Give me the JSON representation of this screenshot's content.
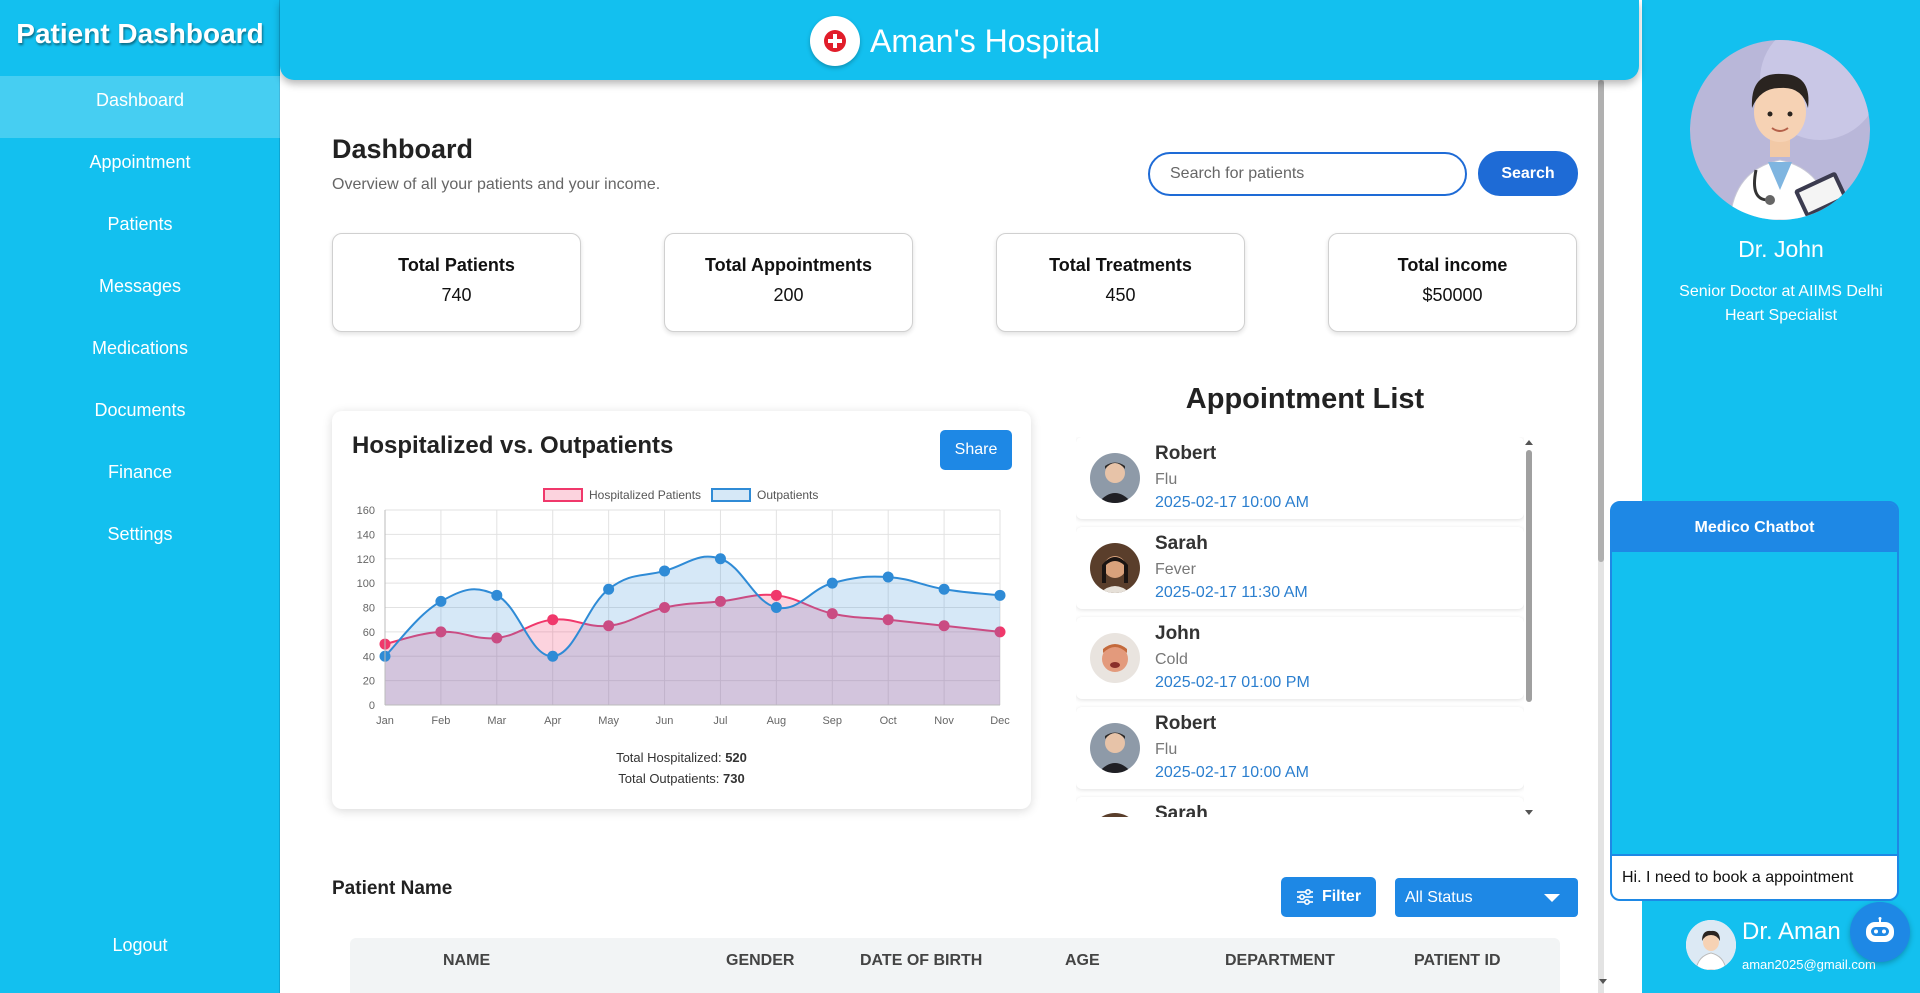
{
  "sidebar": {
    "brand": "Patient Dashboard",
    "items": [
      {
        "label": "Dashboard"
      },
      {
        "label": "Appointment"
      },
      {
        "label": "Patients"
      },
      {
        "label": "Messages"
      },
      {
        "label": "Medications"
      },
      {
        "label": "Documents"
      },
      {
        "label": "Finance"
      },
      {
        "label": "Settings"
      }
    ],
    "logout": "Logout"
  },
  "header": {
    "title": "Aman's Hospital",
    "logo_icon": "hospital-cross-icon"
  },
  "dashboard": {
    "title": "Dashboard",
    "subtitle": "Overview of all your patients and your income.",
    "search_placeholder": "Search for patients",
    "search_button": "Search"
  },
  "stats": [
    {
      "title": "Total Patients",
      "value": "740"
    },
    {
      "title": "Total Appointments",
      "value": "200"
    },
    {
      "title": "Total Treatments",
      "value": "450"
    },
    {
      "title": "Total income",
      "value": "$50000"
    }
  ],
  "chart_card": {
    "title": "Hospitalized vs. Outpatients",
    "share_label": "Share",
    "total_hospitalized_label": "Total Hospitalized:",
    "total_hospitalized": "520",
    "total_outpatients_label": "Total Outpatients:",
    "total_outpatients": "730"
  },
  "chart_data": {
    "type": "area",
    "categories": [
      "Jan",
      "Feb",
      "Mar",
      "Apr",
      "May",
      "Jun",
      "Jul",
      "Aug",
      "Sep",
      "Oct",
      "Nov",
      "Dec"
    ],
    "series": [
      {
        "name": "Hospitalized Patients",
        "values": [
          50,
          60,
          55,
          70,
          65,
          80,
          85,
          90,
          75,
          70,
          65,
          60
        ],
        "color": "#f0386b",
        "fill": "rgba(240,56,107,0.22)"
      },
      {
        "name": "Outpatients",
        "values": [
          40,
          85,
          90,
          40,
          95,
          110,
          120,
          80,
          100,
          105,
          95,
          90
        ],
        "color": "#2f8bd6",
        "fill": "rgba(70,150,220,0.22)"
      }
    ],
    "ylim": [
      0,
      160
    ],
    "yticks": [
      0,
      20,
      40,
      60,
      80,
      100,
      120,
      140,
      160
    ],
    "grid": true,
    "legend": "top-center"
  },
  "appointments": {
    "title": "Appointment List",
    "items": [
      {
        "name": "Robert",
        "condition": "Flu",
        "datetime": "2025-02-17 10:00 AM"
      },
      {
        "name": "Sarah",
        "condition": "Fever",
        "datetime": "2025-02-17 11:30 AM"
      },
      {
        "name": "John",
        "condition": "Cold",
        "datetime": "2025-02-17 01:00 PM"
      },
      {
        "name": "Robert",
        "condition": "Flu",
        "datetime": "2025-02-17 10:00 AM"
      },
      {
        "name": "Sarah",
        "condition": "",
        "datetime": ""
      }
    ]
  },
  "patients_table": {
    "title": "Patient Name",
    "filter_label": "Filter",
    "status_value": "All Status",
    "columns": [
      "NAME",
      "GENDER",
      "DATE OF BIRTH",
      "AGE",
      "DEPARTMENT",
      "PATIENT ID"
    ]
  },
  "profile": {
    "name": "Dr. John",
    "title_line1": "Senior Doctor at AIIMS Delhi",
    "title_line2": "Heart Specialist",
    "user_name": "Dr. Aman",
    "user_email": "aman2025@gmail.com"
  },
  "chatbot": {
    "title": "Medico Chatbot",
    "input_value": "Hi. I need to book a appointment"
  },
  "colors": {
    "primary": "#13c0ef",
    "accent": "#1e88e5",
    "search_button": "#1e6bd6",
    "hospitalized": "#f0386b",
    "outpatients": "#2f8bd6"
  }
}
